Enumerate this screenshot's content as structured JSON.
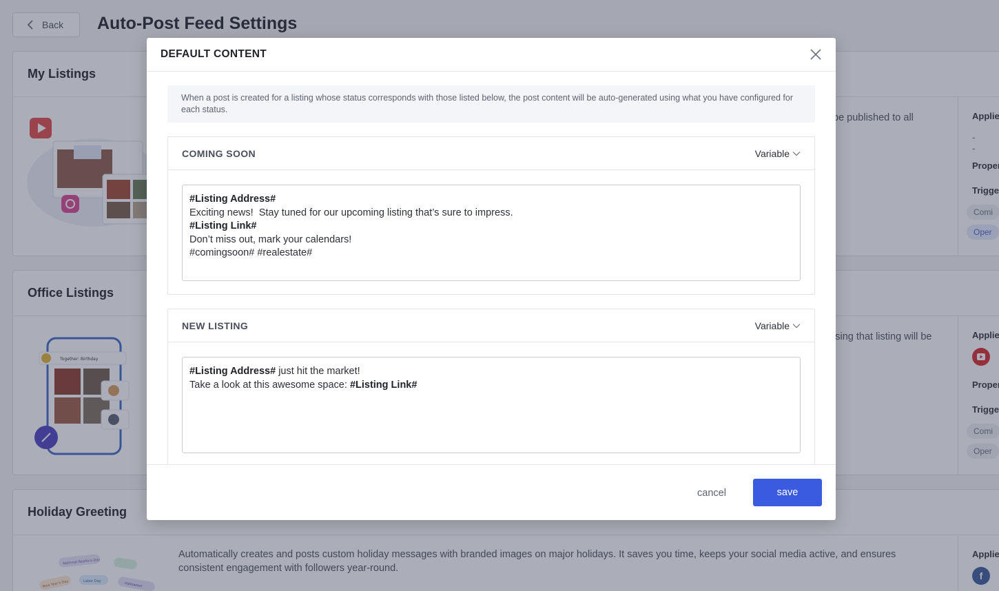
{
  "page": {
    "back_label": "Back",
    "title": "Auto-Post Feed Settings"
  },
  "cards": [
    {
      "title": "My Listings",
      "desc": "be published to all",
      "applied_label": "Applie",
      "applied_value": "--",
      "property_label": "Proper",
      "triggers_label": "Trigge",
      "pills": [
        "Comi",
        "Oper"
      ]
    },
    {
      "title": "Office Listings",
      "desc": "ising that listing will be",
      "applied_label": "Applie",
      "property_label": "Proper",
      "triggers_label": "Trigge",
      "pills": [
        "Comi",
        "Oper"
      ]
    },
    {
      "title": "Holiday Greeting",
      "desc": "Automatically creates and posts custom holiday messages with branded images on major holidays. It saves you time, keeps your social media active, and ensures consistent engagement with followers year-round.",
      "applied_label": "Applie"
    }
  ],
  "illustration_text": {
    "listing_card": "Together: Birthday",
    "holiday_1": "National Realtors Day",
    "holiday_2": "New Year's Day",
    "holiday_3": "Labor Day",
    "holiday_4": "Halloween"
  },
  "modal": {
    "title": "DEFAULT CONTENT",
    "info": "When a post is created for a listing whose status corresponds with those listed below, the post content will be auto-generated using what you have configured for each status.",
    "sections": [
      {
        "title": "COMING SOON",
        "variable_label": "Variable",
        "lines": [
          {
            "bold": "#Listing Address#",
            "text": ""
          },
          {
            "bold": "",
            "text": "Exciting news!  Stay tuned for our upcoming listing that’s sure to impress."
          },
          {
            "bold": "#Listing Link#",
            "text": ""
          },
          {
            "bold": "",
            "text": "Don’t miss out, mark your calendars!"
          },
          {
            "bold": "",
            "text": "#comingsoon# #realestate#"
          }
        ]
      },
      {
        "title": "NEW LISTING",
        "variable_label": "Variable",
        "line1_bold": "#Listing Address#",
        "line1_text": " just hit the market!",
        "line2_text": "Take a look at this awesome space: ",
        "line2_bold": "#Listing Link#"
      }
    ],
    "cancel_label": "cancel",
    "save_label": "save"
  },
  "colors": {
    "primary": "#3a5be0",
    "overlay": "#383e56",
    "youtube": "#d9252a",
    "facebook": "#3b5998"
  }
}
